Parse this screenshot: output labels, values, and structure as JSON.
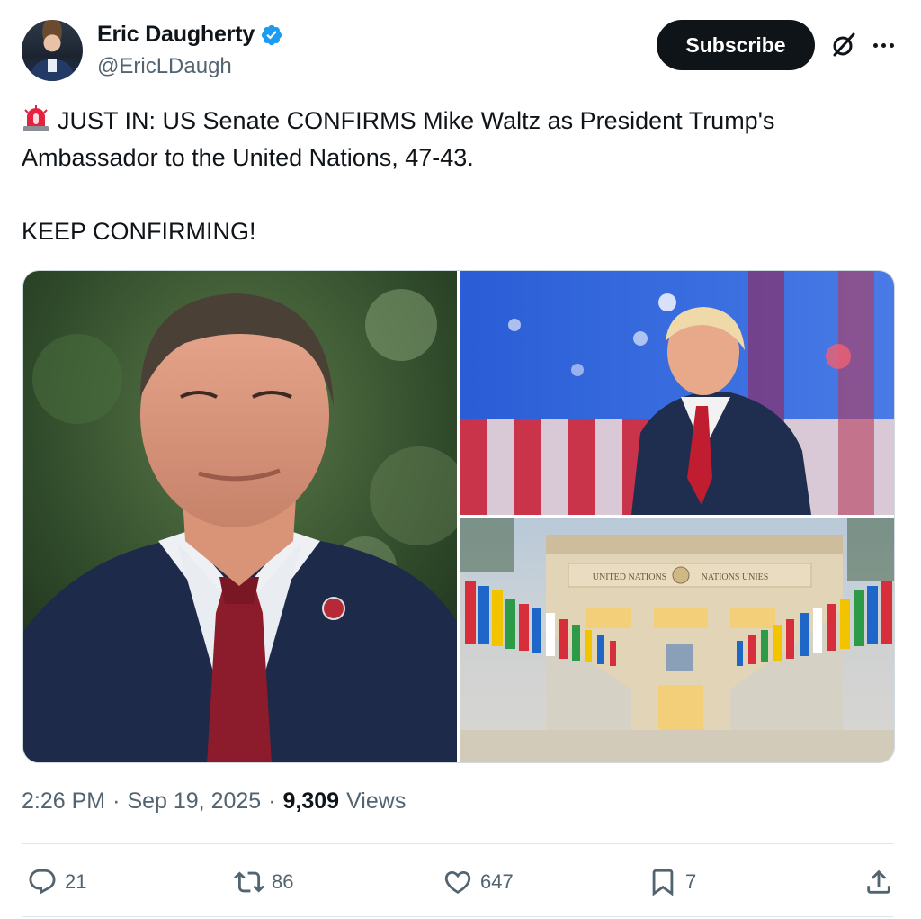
{
  "author": {
    "name": "Eric Daugherty",
    "handle": "@EricLDaugh",
    "verified": true
  },
  "header": {
    "subscribe_label": "Subscribe",
    "grok_icon": "grok-icon",
    "more_icon": "more-icon"
  },
  "tweet": {
    "emoji": "🚨",
    "line1": "JUST IN: US Senate CONFIRMS Mike Waltz as President Trump's Ambassador to the United Nations, 47-43.",
    "line2": "KEEP CONFIRMING!"
  },
  "media": {
    "building_sign_left": "UNITED NATIONS",
    "building_sign_right": "NATIONS UNIES"
  },
  "meta": {
    "time": "2:26 PM",
    "date": "Sep 19, 2025",
    "views_count": "9,309",
    "views_label": "Views",
    "separator": "·"
  },
  "actions": {
    "replies": "21",
    "reposts": "86",
    "likes": "647",
    "bookmarks": "7"
  },
  "colors": {
    "text_primary": "#0f1419",
    "text_secondary": "#536471",
    "verified_blue": "#1d9bf0",
    "border": "#cfd9de"
  }
}
